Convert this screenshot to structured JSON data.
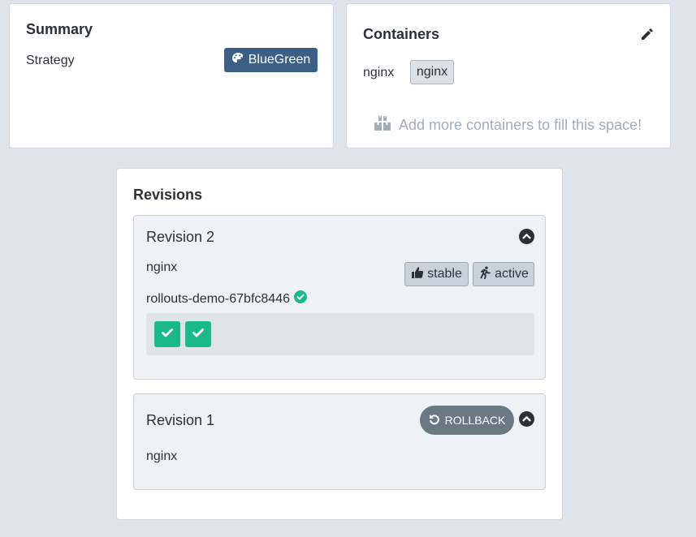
{
  "summary": {
    "title": "Summary",
    "strategy_label": "Strategy",
    "strategy_value": "BlueGreen",
    "strategy_icon": "palette-icon",
    "badge_color": "#3b5f85"
  },
  "containers": {
    "title": "Containers",
    "edit_icon": "pencil-icon",
    "items": [
      {
        "name": "nginx",
        "image": "nginx"
      }
    ],
    "empty_hint": "Add more containers to fill this space!",
    "empty_hint_icon": "boxes-icon"
  },
  "revisions": {
    "title": "Revisions",
    "items": [
      {
        "label": "Revision 2",
        "image": "nginx",
        "tags": [
          {
            "label": "stable",
            "icon": "thumbs-up-icon"
          },
          {
            "label": "active",
            "icon": "running-icon"
          }
        ],
        "replicaset": "rollouts-demo-67bfc8446",
        "replicaset_status_icon": "check-circle-icon",
        "pods": [
          {
            "status": "healthy",
            "icon": "check-icon"
          },
          {
            "status": "healthy",
            "icon": "check-icon"
          }
        ],
        "expanded": true
      },
      {
        "label": "Revision 1",
        "image": "nginx",
        "rollback_label": "ROLLBACK",
        "rollback_icon": "undo-icon",
        "expanded": true
      }
    ]
  },
  "colors": {
    "page_bg": "#dee4ea",
    "healthy": "#19b98b",
    "rollback_bg": "#6a7884",
    "text": "#2c3138"
  }
}
